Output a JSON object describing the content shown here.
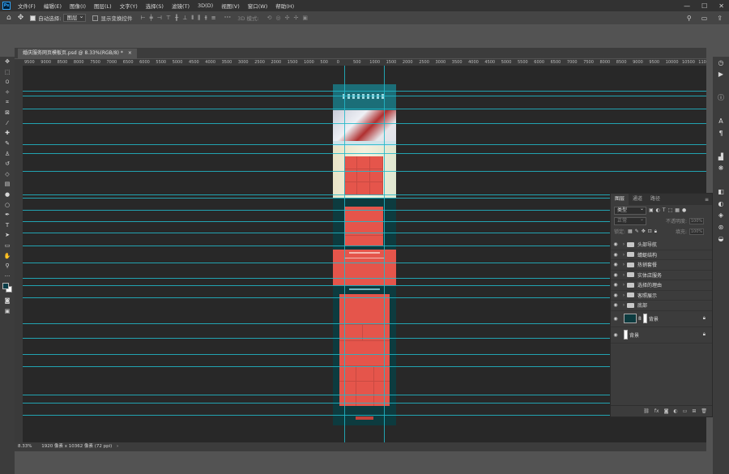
{
  "app": {
    "logo": "Ps"
  },
  "menu": [
    "文件(F)",
    "编辑(E)",
    "图像(I)",
    "图层(L)",
    "文字(Y)",
    "选择(S)",
    "滤镜(T)",
    "3D(D)",
    "视图(V)",
    "窗口(W)",
    "帮助(H)"
  ],
  "window_controls": {
    "minimize": "—",
    "maximize": "☐",
    "close": "✕"
  },
  "options_bar": {
    "auto_select_label": "自动选择:",
    "auto_select_value": "图层",
    "show_transform_label": "显示变换控件",
    "mode_label": "3D 模式:",
    "more": "···"
  },
  "document_tab": {
    "title": "婚庆服务网页模板页.psd @ 8.33%(RGB/8) *",
    "close": "×"
  },
  "ruler_top_labels": [
    "9500",
    "9000",
    "8500",
    "8000",
    "7500",
    "7000",
    "6500",
    "6000",
    "5500",
    "5000",
    "4500",
    "4000",
    "3500",
    "3000",
    "2500",
    "2000",
    "1500",
    "1000",
    "500",
    "0",
    "500",
    "1000",
    "1500",
    "2000",
    "2500",
    "3000",
    "3500",
    "4000",
    "4500",
    "5000",
    "5500",
    "6000",
    "6500",
    "7000",
    "7500",
    "8000",
    "8500",
    "9000",
    "9500",
    "10000",
    "10500",
    "11000"
  ],
  "status_bar": {
    "zoom": "8.33%",
    "doc_info": "1920 像素 x 10362 像素 (72 ppi)"
  },
  "tools": [
    "move",
    "marquee",
    "lasso",
    "magic-wand",
    "crop",
    "frame",
    "eyedropper",
    "healing",
    "brush",
    "stamp",
    "history-brush",
    "eraser",
    "gradient",
    "blur",
    "dodge",
    "pen",
    "type",
    "path-select",
    "shape",
    "hand",
    "zoom",
    "more"
  ],
  "colors": {
    "foreground": "#0a3d48",
    "background": "#ffffff",
    "guide": "#21b8c9",
    "salmon": "#e5554b",
    "doc_bg": "#0d3b3f"
  },
  "layers_panel": {
    "tabs": [
      "图层",
      "通道",
      "路径"
    ],
    "menu": "≡",
    "filter_select": "类型",
    "blend_mode": "正常",
    "opacity_label": "不透明度:",
    "opacity_value": "100%",
    "lock_label": "锁定:",
    "fill_label": "填充:",
    "fill_value": "100%",
    "groups": [
      "头部导航",
      "蜻蜓结构",
      "热销套餐",
      "实体店服务",
      "选择的理由",
      "客照展示",
      "底部"
    ],
    "layers": [
      {
        "name": "背景",
        "locked": true
      },
      {
        "name": "背景",
        "locked": true
      }
    ]
  }
}
